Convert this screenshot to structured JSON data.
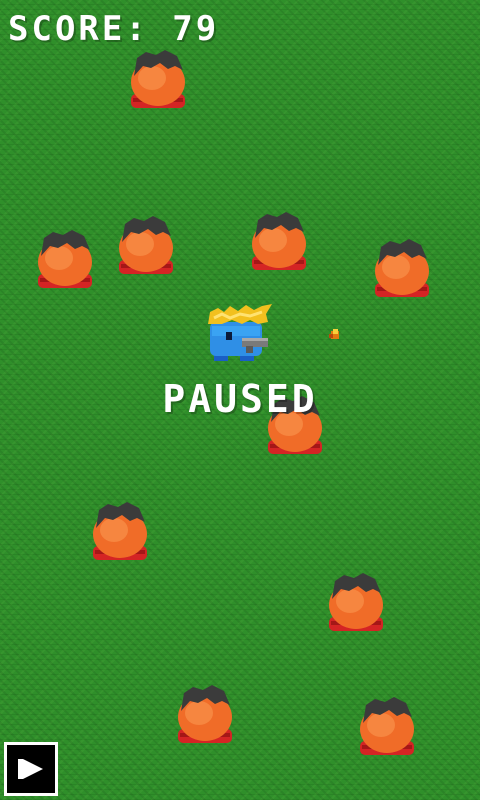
{
  "hud": {
    "score_text": "SCORE: 79"
  },
  "status": {
    "paused_text": "PAUSED"
  },
  "controls": {
    "play_icon": "play-icon"
  }
}
